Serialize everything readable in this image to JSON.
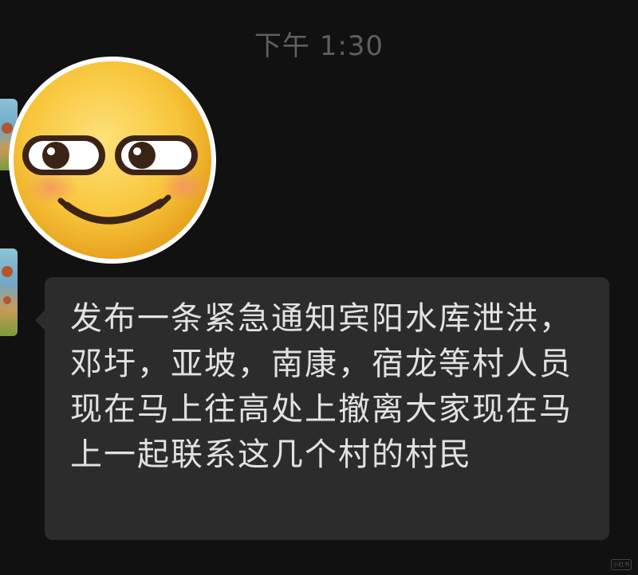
{
  "chat": {
    "timestamp": "下午 1:30",
    "messages": [
      {
        "type": "sticker",
        "sticker_icon": "smirk-emoji-icon"
      },
      {
        "type": "text",
        "text": "发布一条紧急通知宾阳水库泄洪，邓圩，亚坡，南康，宿龙等村人员现在马上往高处上撤离大家现在马上一起联系这几个村的村民"
      }
    ]
  },
  "colors": {
    "background": "#111111",
    "bubble": "#2c2c2c",
    "text": "#e2e2e2",
    "timestamp": "#5f5f5f",
    "emoji_face": "#f7c331"
  }
}
